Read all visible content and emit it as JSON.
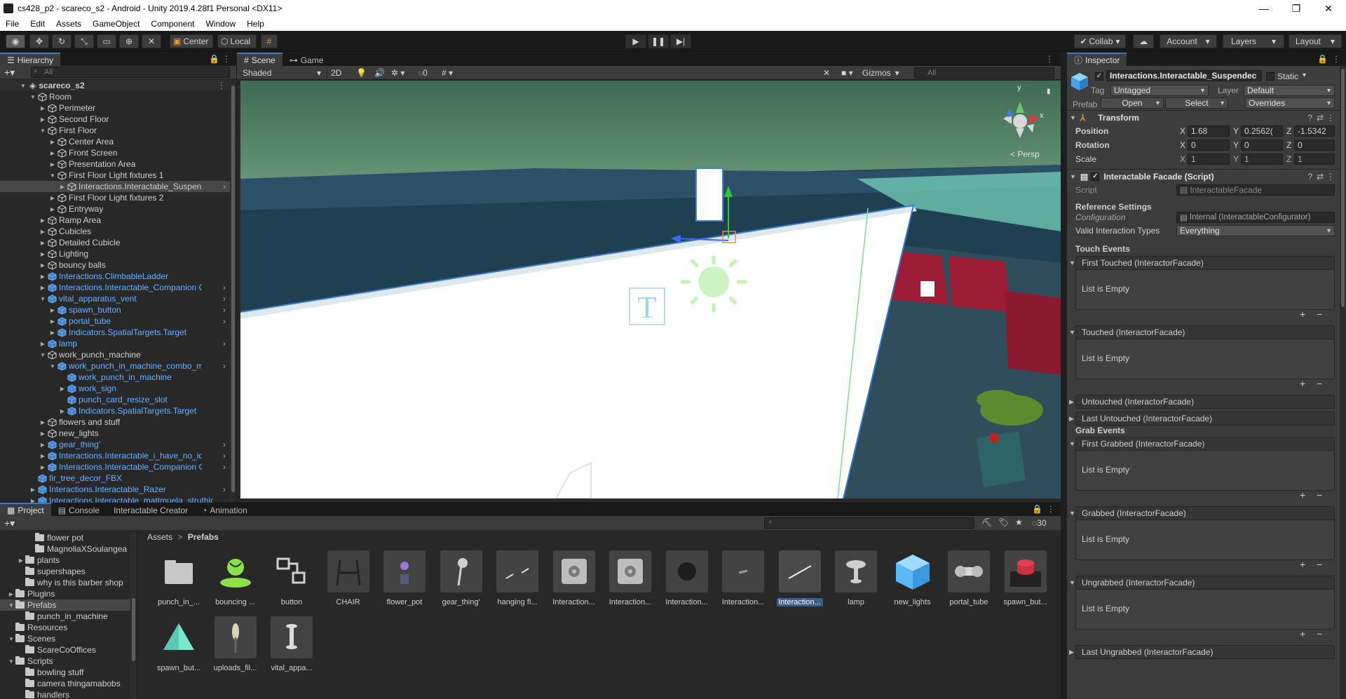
{
  "window": {
    "title": "cs428_p2 - scareco_s2 - Android - Unity 2019.4.28f1 Personal <DX11>",
    "minimize": "—",
    "maximize": "❐",
    "close": "✕"
  },
  "menu": [
    "File",
    "Edit",
    "Assets",
    "GameObject",
    "Component",
    "Window",
    "Help"
  ],
  "toolbar": {
    "pivot": "Center",
    "space": "Local",
    "collab": "Collab",
    "account": "Account",
    "layers": "Layers",
    "layout": "Layout"
  },
  "hierarchy": {
    "tab": "Hierarchy",
    "search_placeholder": "All",
    "scene": "scareco_s2",
    "rows": [
      {
        "label": "Room",
        "indent": 1,
        "arrow": "▼",
        "blue": false
      },
      {
        "label": "Perimeter",
        "indent": 2,
        "arrow": "▶",
        "blue": false
      },
      {
        "label": "Second Floor",
        "indent": 2,
        "arrow": "▶",
        "blue": false
      },
      {
        "label": "First Floor",
        "indent": 2,
        "arrow": "▼",
        "blue": false
      },
      {
        "label": "Center Area",
        "indent": 3,
        "arrow": "▶",
        "blue": false
      },
      {
        "label": "Front Screen",
        "indent": 3,
        "arrow": "▶",
        "blue": false
      },
      {
        "label": "Presentation Area",
        "indent": 3,
        "arrow": "▶",
        "blue": false
      },
      {
        "label": "First Floor Light fixtures 1",
        "indent": 3,
        "arrow": "▼",
        "blue": false
      },
      {
        "label": "Interactions.Interactable_Suspend",
        "indent": 4,
        "arrow": "▶",
        "blue": false,
        "sel": true,
        "more": true
      },
      {
        "label": "First Floor Light fixtures 2",
        "indent": 3,
        "arrow": "▶",
        "blue": false
      },
      {
        "label": "Entryway",
        "indent": 3,
        "arrow": "▶",
        "blue": false
      },
      {
        "label": "Ramp Area",
        "indent": 2,
        "arrow": "▶",
        "blue": false
      },
      {
        "label": "Cubicles",
        "indent": 2,
        "arrow": "▶",
        "blue": false
      },
      {
        "label": "Detailed Cubicle",
        "indent": 2,
        "arrow": "▶",
        "blue": false
      },
      {
        "label": "Lighting",
        "indent": 2,
        "arrow": "▶",
        "blue": false
      },
      {
        "label": "bouncy balls",
        "indent": 2,
        "arrow": "▶",
        "blue": false
      },
      {
        "label": "Interactions.ClimbableLadder",
        "indent": 2,
        "arrow": "▶",
        "blue": true
      },
      {
        "label": "Interactions.Interactable_Companion C",
        "indent": 2,
        "arrow": "▶",
        "blue": true,
        "more": true
      },
      {
        "label": "vital_apparatus_vent",
        "indent": 2,
        "arrow": "▼",
        "blue": true,
        "more": true
      },
      {
        "label": "spawn_button",
        "indent": 3,
        "arrow": "▶",
        "blue": true,
        "more": true
      },
      {
        "label": "portal_tube",
        "indent": 3,
        "arrow": "▶",
        "blue": true,
        "more": true
      },
      {
        "label": "Indicators.SpatialTargets.Target",
        "indent": 3,
        "arrow": "▶",
        "blue": true
      },
      {
        "label": "lamp",
        "indent": 2,
        "arrow": "▶",
        "blue": true,
        "more": true
      },
      {
        "label": "work_punch_machine",
        "indent": 2,
        "arrow": "▼",
        "blue": false
      },
      {
        "label": "work_punch_in_machine_combo_mea",
        "indent": 3,
        "arrow": "▼",
        "blue": true,
        "more": true
      },
      {
        "label": "work_punch_in_machine",
        "indent": 4,
        "arrow": "",
        "blue": true
      },
      {
        "label": "work_sign",
        "indent": 4,
        "arrow": "▶",
        "blue": true
      },
      {
        "label": "punch_card_resize_slot",
        "indent": 4,
        "arrow": "",
        "blue": true
      },
      {
        "label": "Indicators.SpatialTargets.Target",
        "indent": 4,
        "arrow": "▶",
        "blue": true
      },
      {
        "label": "flowers and stuff",
        "indent": 2,
        "arrow": "▶",
        "blue": false
      },
      {
        "label": "new_lights",
        "indent": 2,
        "arrow": "▶",
        "blue": false
      },
      {
        "label": "gear_thing'",
        "indent": 2,
        "arrow": "▶",
        "blue": true,
        "more": true
      },
      {
        "label": "Interactions.Interactable_i_have_no_ide",
        "indent": 2,
        "arrow": "▶",
        "blue": true,
        "more": true
      },
      {
        "label": "Interactions.Interactable_Companion C",
        "indent": 2,
        "arrow": "▶",
        "blue": true,
        "more": true
      },
      {
        "label": "fir_tree_decor_FBX",
        "indent": 1,
        "arrow": "",
        "blue": true
      },
      {
        "label": "Interactions.Interactable_Razer",
        "indent": 1,
        "arrow": "▶",
        "blue": true,
        "more": true
      },
      {
        "label": "Interactions.Interactable_mattmuela_struthio",
        "indent": 1,
        "arrow": "▶",
        "blue": true
      }
    ]
  },
  "scene": {
    "tab_scene": "Scene",
    "tab_game": "Game",
    "shading": "Shaded",
    "mode_2d": "2D",
    "hidden_count": "0",
    "gizmos": "Gizmos",
    "search_placeholder": "All",
    "persp": "< Persp",
    "axis_y": "y",
    "axis_x": "x"
  },
  "inspector": {
    "tab": "Inspector",
    "object_name": "Interactions.Interactable_Suspendec",
    "static_label": "Static",
    "tag_label": "Tag",
    "tag_value": "Untagged",
    "layer_label": "Layer",
    "layer_value": "Default",
    "prefab_label": "Prefab",
    "prefab_open": "Open",
    "prefab_select": "Select",
    "prefab_overrides": "Overrides",
    "transform": {
      "title": "Transform",
      "position_label": "Position",
      "position": {
        "x": "1.68",
        "y": "0.2562(",
        "z": "-1.5342"
      },
      "rotation_label": "Rotation",
      "rotation": {
        "x": "0",
        "y": "0",
        "z": "0"
      },
      "scale_label": "Scale",
      "scale": {
        "x": "1",
        "y": "1",
        "z": "1"
      }
    },
    "facade": {
      "title": "Interactable Facade (Script)",
      "script_label": "Script",
      "script_value": "InteractableFacade",
      "ref_settings": "Reference Settings",
      "config_label": "Configuration",
      "config_value": "Internal (InteractableConfigurator)",
      "valid_label": "Valid Interaction Types",
      "valid_value": "Everything",
      "touch_events": "Touch Events",
      "grab_events": "Grab Events"
    },
    "events": [
      {
        "label": "First Touched (InteractorFacade)",
        "expanded": true
      },
      {
        "label": "Touched (InteractorFacade)",
        "expanded": true
      },
      {
        "label": "Untouched (InteractorFacade)",
        "expanded": false
      },
      {
        "label": "Last Untouched (InteractorFacade)",
        "expanded": false
      },
      {
        "label": "First Grabbed (InteractorFacade)",
        "expanded": true
      },
      {
        "label": "Grabbed (InteractorFacade)",
        "expanded": true
      },
      {
        "label": "Ungrabbed (InteractorFacade)",
        "expanded": true
      },
      {
        "label": "Last Ungrabbed (InteractorFacade)",
        "expanded": false
      }
    ],
    "list_empty": "List is Empty"
  },
  "project": {
    "tab_project": "Project",
    "tab_console": "Console",
    "tab_creator": "Interactable Creator",
    "tab_animation": "Animation",
    "hidden_count": "30",
    "breadcrumb_root": "Assets",
    "breadcrumb_sep": ">",
    "breadcrumb_current": "Prefabs",
    "folders": [
      {
        "label": "flower pot",
        "indent": 3,
        "arrow": "",
        "sel": false
      },
      {
        "label": "MagnoliaXSoulangea",
        "indent": 3,
        "arrow": "",
        "sel": false
      },
      {
        "label": "plants",
        "indent": 2,
        "arrow": "▶",
        "sel": false
      },
      {
        "label": "supershapes",
        "indent": 2,
        "arrow": "",
        "sel": false
      },
      {
        "label": "why is this barber shop",
        "indent": 2,
        "arrow": "",
        "sel": false
      },
      {
        "label": "Plugins",
        "indent": 1,
        "arrow": "▶",
        "sel": false
      },
      {
        "label": "Prefabs",
        "indent": 1,
        "arrow": "▼",
        "sel": true
      },
      {
        "label": "punch_in_machine",
        "indent": 2,
        "arrow": "",
        "sel": false
      },
      {
        "label": "Resources",
        "indent": 1,
        "arrow": "",
        "sel": false
      },
      {
        "label": "Scenes",
        "indent": 1,
        "arrow": "▼",
        "sel": false
      },
      {
        "label": "ScareCoOffices",
        "indent": 2,
        "arrow": "",
        "sel": false
      },
      {
        "label": "Scripts",
        "indent": 1,
        "arrow": "▼",
        "sel": false
      },
      {
        "label": "bowling stuff",
        "indent": 2,
        "arrow": "",
        "sel": false
      },
      {
        "label": "camera thingamabobs",
        "indent": 2,
        "arrow": "",
        "sel": false
      },
      {
        "label": "handlers",
        "indent": 2,
        "arrow": "",
        "sel": false
      }
    ],
    "assets": [
      {
        "label": "punch_in_...",
        "icon": "folder-icon"
      },
      {
        "label": "bouncing ...",
        "icon": "bouncing-prefab-icon"
      },
      {
        "label": "button",
        "icon": "button-prefab-icon"
      },
      {
        "label": "CHAIR",
        "icon": "chair-prefab-icon"
      },
      {
        "label": "flower_pot",
        "icon": "flower-pot-prefab-icon"
      },
      {
        "label": "gear_thing'",
        "icon": "gear-thing-prefab-icon"
      },
      {
        "label": "hanging fl...",
        "icon": "hanging-fixture-prefab-icon"
      },
      {
        "label": "Interaction...",
        "icon": "companion-cube-prefab-icon"
      },
      {
        "label": "Interaction...",
        "icon": "companion-cube-prefab-icon"
      },
      {
        "label": "Interaction...",
        "icon": "sphere-prefab-icon"
      },
      {
        "label": "Interaction...",
        "icon": "razer-prefab-icon"
      },
      {
        "label": "Interaction...",
        "icon": "suspended-prefab-icon",
        "sel": true
      },
      {
        "label": "lamp",
        "icon": "lamp-prefab-icon"
      },
      {
        "label": "new_lights",
        "icon": "cube-prefab-icon"
      },
      {
        "label": "portal_tube",
        "icon": "portal-tube-prefab-icon"
      },
      {
        "label": "spawn_but...",
        "icon": "spawn-button-prefab-icon"
      },
      {
        "label": "spawn_but...",
        "icon": "spawn-triangle-prefab-icon"
      },
      {
        "label": "uploads_fil...",
        "icon": "uploads-prefab-icon"
      },
      {
        "label": "vital_appa...",
        "icon": "vital-apparatus-prefab-icon"
      }
    ]
  },
  "colors": {
    "accent": "#3a79bb",
    "prefab_blue": "#6ab0ff",
    "panel": "#282828",
    "panel_light": "#3c3c3c"
  }
}
